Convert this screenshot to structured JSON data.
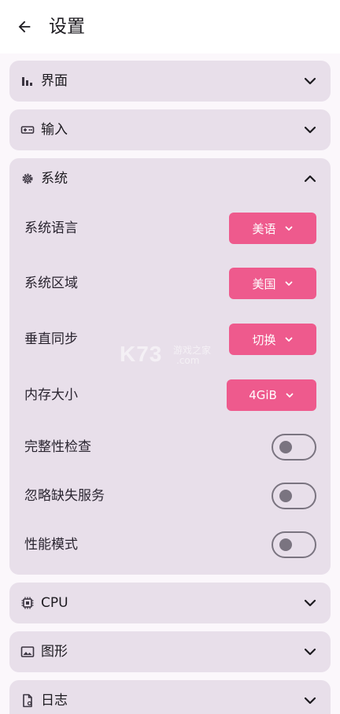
{
  "header": {
    "title": "设置"
  },
  "sections": {
    "interface": {
      "label": "界面",
      "icon": "bar-chart-icon",
      "expanded": false
    },
    "input": {
      "label": "输入",
      "icon": "gamepad-icon",
      "expanded": false
    },
    "system": {
      "label": "系统",
      "icon": "gear-icon",
      "expanded": true,
      "language": {
        "label": "系统语言",
        "value": "美语"
      },
      "region": {
        "label": "系统区域",
        "value": "美国"
      },
      "vsync": {
        "label": "垂直同步",
        "value": "切换"
      },
      "memory": {
        "label": "内存大小",
        "value": "4GiB"
      },
      "integrity": {
        "label": "完整性检查",
        "enabled": false
      },
      "ignore_missing": {
        "label": "忽略缺失服务",
        "enabled": false
      },
      "performance": {
        "label": "性能模式",
        "enabled": false
      }
    },
    "cpu": {
      "label": "CPU",
      "icon": "chip-icon",
      "expanded": false
    },
    "graphics": {
      "label": "图形",
      "icon": "image-icon",
      "expanded": false
    },
    "logs": {
      "label": "日志",
      "icon": "file-icon",
      "expanded": false
    }
  },
  "watermark": {
    "brand": "K73",
    "tagline": "游戏之家",
    "domain": ".com"
  },
  "colors": {
    "accent": "#ee5a8d",
    "card": "#e8dfea",
    "background": "#fbf7fb"
  }
}
